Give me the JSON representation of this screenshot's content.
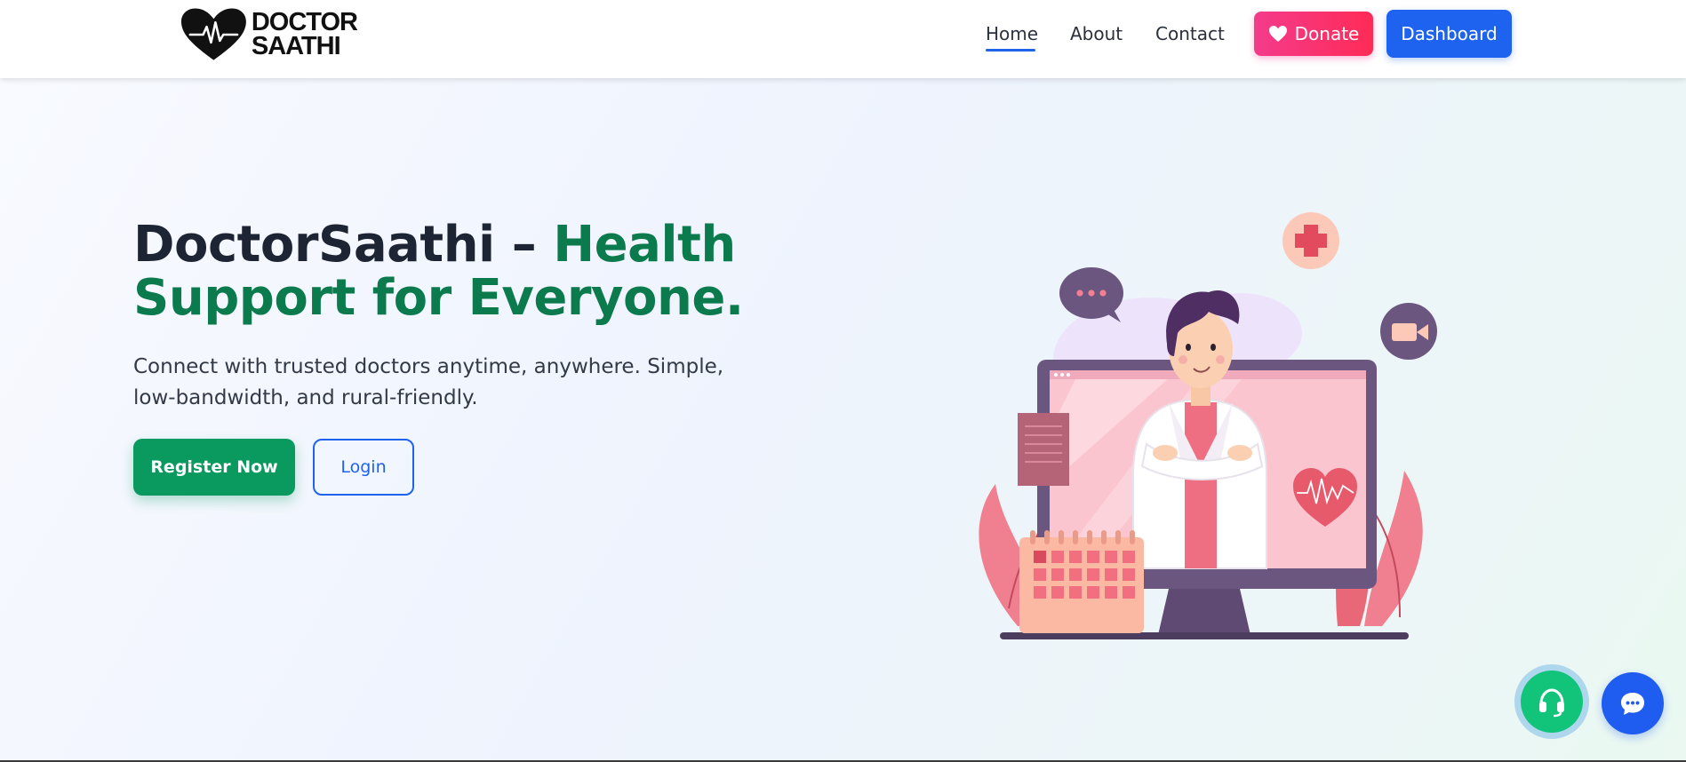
{
  "brand": {
    "line1": "DOCTOR",
    "line2": "SAATHI"
  },
  "nav": {
    "items": [
      {
        "label": "Home",
        "active": true
      },
      {
        "label": "About",
        "active": false
      },
      {
        "label": "Contact",
        "active": false
      }
    ],
    "donate_label": "Donate",
    "dashboard_label": "Dashboard"
  },
  "hero": {
    "title_prefix": "DoctorSaathi – ",
    "title_accent": "Health Support for Everyone.",
    "subtitle": "Connect with trusted doctors anytime, anywhere. Simple, low-bandwidth, and rural-friendly.",
    "register_label": "Register Now",
    "login_label": "Login"
  },
  "floating": {
    "support_icon": "headset-icon",
    "chat_icon": "chat-bubble-icon"
  },
  "colors": {
    "accent_green": "#0b7a4d",
    "primary_blue": "#1e63f0",
    "donate_pink": "#f43b8c"
  }
}
